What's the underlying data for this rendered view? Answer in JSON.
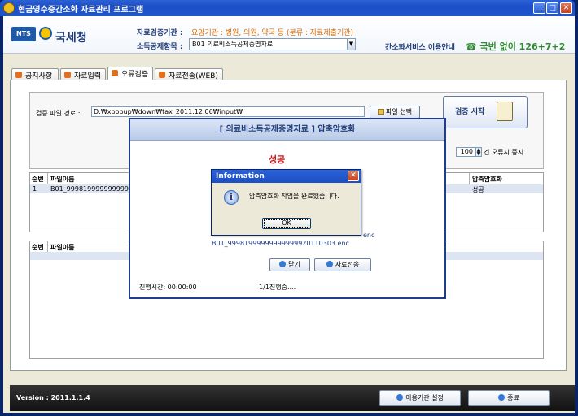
{
  "window": {
    "title": "현금영수증간소화 자료관리 프로그램",
    "minimize": "_",
    "maximize": "□",
    "close": "✕"
  },
  "header": {
    "logo_text": "NTS",
    "brand": "국세청",
    "agency_label": "자료검증기관 :",
    "agency_value": "요양기관 : 병원, 의원, 약국 등 (분류 : 자료제출기관)",
    "item_label": "소득공제항목 :",
    "item_value": "B01 의료비소득공제증명자료",
    "service": "간소화서비스 이용안내",
    "phone": "☎ 국번 없이 126+7+2"
  },
  "tabs": [
    {
      "label": "공지사항"
    },
    {
      "label": "자료입력"
    },
    {
      "label": "오류검증"
    },
    {
      "label": "자료전송(WEB)"
    }
  ],
  "verify": {
    "path_label": "검증 파일 경로 :",
    "path_value": "D:₩xpopup₩down₩tax_2011.12.06₩input₩",
    "file_button": "파일 선택",
    "start_button": "검증 시작",
    "error_count": "100",
    "error_label": "건 오류시 중지"
  },
  "grid1": {
    "headers": [
      "순번",
      "파일이름",
      "압축암호화"
    ],
    "rows": [
      {
        "no": "1",
        "name": "B01_99981999999999999992",
        "status": "성공"
      }
    ]
  },
  "grid2": {
    "headers": [
      "순번",
      "파일이름"
    ]
  },
  "footer": {
    "version": "Version : 2011.1.1.4",
    "agency_setting": "이용기관 설정",
    "exit": "종료"
  },
  "progress_dialog": {
    "title": "[ 의료비소득공제증명자료 ] 압축암호화",
    "success": "성공",
    "enc": "enc",
    "file": "B01_99981999999999999920110303.enc",
    "close_button": "닫기",
    "send_button": "자료전송",
    "elapsed": "진행시간: 00:00:00",
    "progress": "1/1진행중...."
  },
  "info_dialog": {
    "title": "Information",
    "message": "압축암호화 작업을 완료했습니다.",
    "ok": "OK",
    "icon_glyph": "i"
  }
}
